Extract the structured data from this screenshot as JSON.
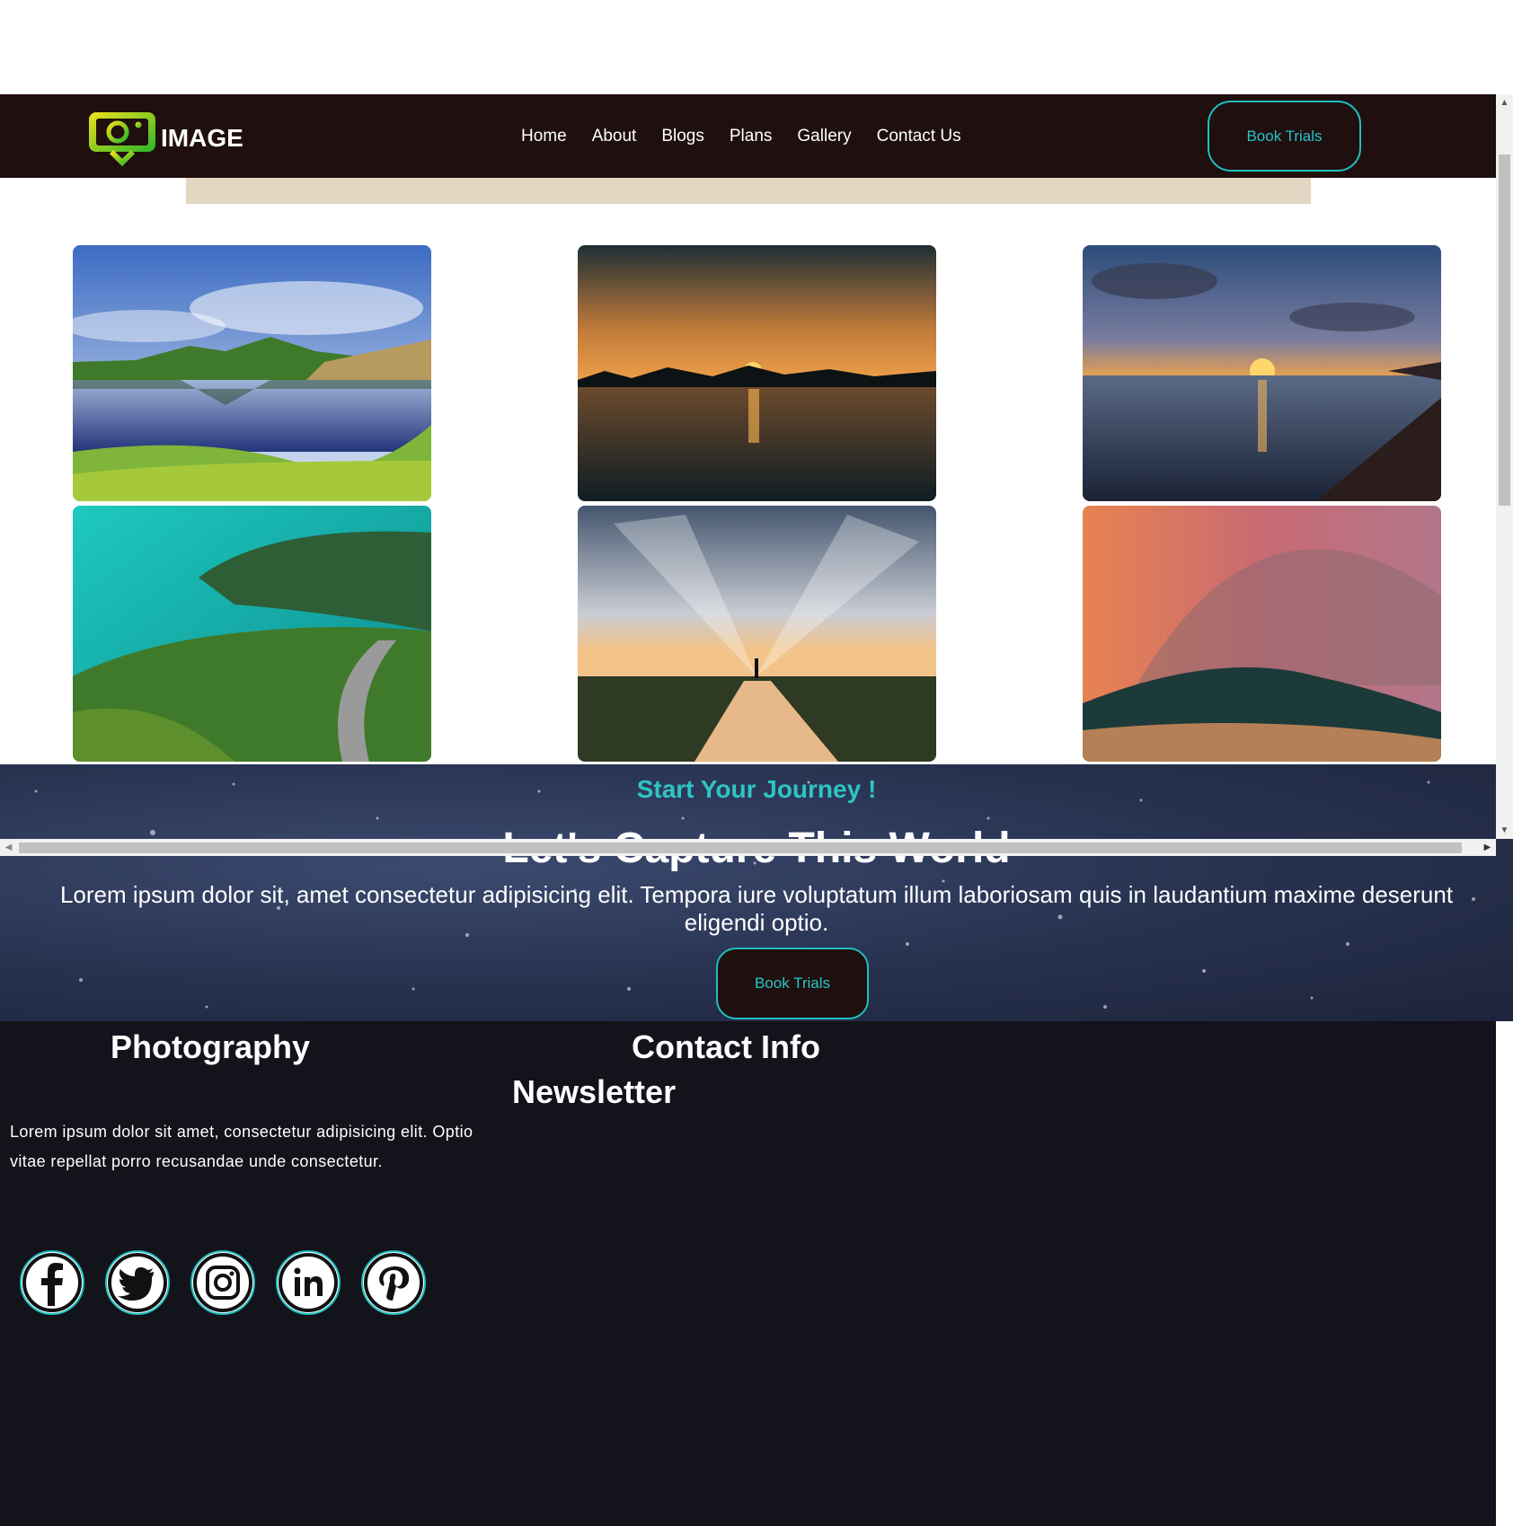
{
  "header": {
    "logo_text": "IMAGE",
    "nav": [
      "Home",
      "About",
      "Blogs",
      "Plans",
      "Gallery",
      "Contact Us"
    ],
    "cta_label": "Book Trials"
  },
  "gallery": {
    "photos": [
      "lake-mountain-landscape",
      "palm-tree-sunset-over-water",
      "ocean-sunset-shoreline",
      "coastal-road-turquoise-sea",
      "person-under-dramatic-sky-reflection",
      "curling-ocean-wave"
    ]
  },
  "cta": {
    "subtitle": "Start Your Journey !",
    "title": "Let's Capture This World",
    "text": "Lorem ipsum dolor sit, amet consectetur adipisicing elit. Tempora iure voluptatum illum laboriosam quis in laudantium maxime deserunt eligendi optio.",
    "button_label": "Book Trials"
  },
  "footer": {
    "photography_heading": "Photography",
    "contact_heading": "Contact Info",
    "newsletter_heading": "Newsletter",
    "text": "Lorem ipsum dolor sit amet, consectetur adipisicing elit. Optio vitae repellat porro recusandae unde consectetur.",
    "socials": [
      "facebook-icon",
      "twitter-icon",
      "instagram-icon",
      "linkedin-icon",
      "pinterest-icon"
    ]
  },
  "colors": {
    "nav_bg": "#200f0f",
    "accent": "#23c6c6",
    "footer_bg": "#12131b",
    "beige_bar": "#e3d6c3"
  }
}
